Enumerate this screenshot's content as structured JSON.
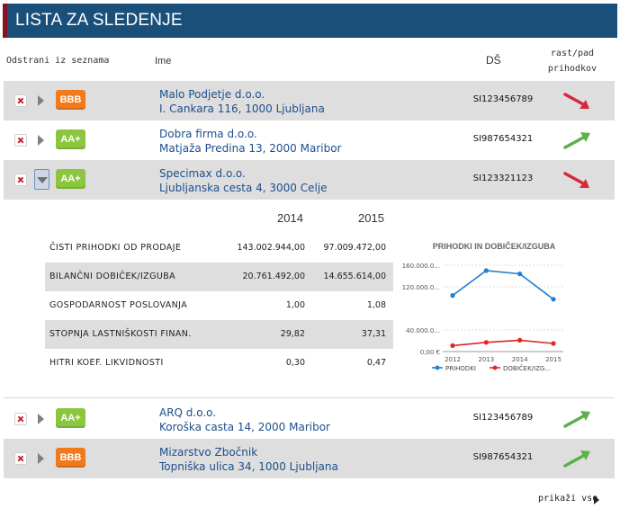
{
  "header": {
    "title": "LISTA ZA SLEDENJE"
  },
  "columns": {
    "remove": "Odstrani iz seznama",
    "name": "Ime",
    "ds": "DŠ",
    "trend_line1": "rast/pad",
    "trend_line2": "prihodkov"
  },
  "rows": [
    {
      "badge": "BBB",
      "name": "Malo Podjetje d.o.o.",
      "address": "I. Cankara 116, 1000 Ljubljana",
      "ds": "SI123456789",
      "trend": "down"
    },
    {
      "badge": "AA+",
      "name": "Dobra firma d.o.o.",
      "address": "Matjaža Predina 13, 2000 Maribor",
      "ds": "SI987654321",
      "trend": "up"
    },
    {
      "badge": "AA+",
      "name": "Specimax d.o.o.",
      "address": "Ljubljanska cesta 4, 3000 Celje",
      "ds": "SI123321123",
      "trend": "down"
    },
    {
      "badge": "AA+",
      "name": "ARQ d.o.o.",
      "address": "Koroška casta 14, 2000 Maribor",
      "ds": "SI123456789",
      "trend": "up"
    },
    {
      "badge": "BBB",
      "name": "Mizarstvo Zbočnik",
      "address": "Topniška ulica 34, 1000 Ljubljana",
      "ds": "SI987654321",
      "trend": "up"
    }
  ],
  "detail": {
    "years": [
      "2014",
      "2015"
    ],
    "rows": [
      {
        "label": "ČISTI PRIHODKI OD PRODAJE",
        "v2014": "143.002.944,00",
        "v2015": "97.009.472,00"
      },
      {
        "label": "BILANČNI DOBIČEK/IZGUBA",
        "v2014": "20.761.492,00",
        "v2015": "14.655.614,00"
      },
      {
        "label": "GOSPODARNOST POSLOVANJA",
        "v2014": "1,00",
        "v2015": "1,08"
      },
      {
        "label": "STOPNJA LASTNIŠKOSTI FINAN.",
        "v2014": "29,82",
        "v2015": "37,31"
      },
      {
        "label": "HITRI KOEF. LIKVIDNOSTI",
        "v2014": "0,30",
        "v2015": "0,47"
      }
    ]
  },
  "chart_data": {
    "type": "line",
    "title": "PRIHODKI IN DOBIČEK/IZGUBA",
    "x": [
      "2012",
      "2013",
      "2014",
      "2015"
    ],
    "y_ticks": [
      "0,00 €",
      "40.000.0...",
      "120.000.0...",
      "160.000.0..."
    ],
    "y_tick_values": [
      0,
      40000000,
      120000000,
      160000000
    ],
    "ylim": [
      0,
      165000000
    ],
    "series": [
      {
        "name": "PRIHODKI",
        "color": "#1f7fd0",
        "values": [
          104000000,
          150000000,
          144000000,
          97000000
        ]
      },
      {
        "name": "DOBIČEK/IZG...",
        "color": "#e02424",
        "values": [
          11000000,
          17000000,
          21000000,
          15000000
        ]
      }
    ]
  },
  "footer": {
    "more": "prikaži vse"
  },
  "colors": {
    "header": "#1a4f7a",
    "header_accent": "#8a1020",
    "link": "#1d4f8e",
    "trend_up": "#5ab04a",
    "trend_down": "#d8283c"
  }
}
